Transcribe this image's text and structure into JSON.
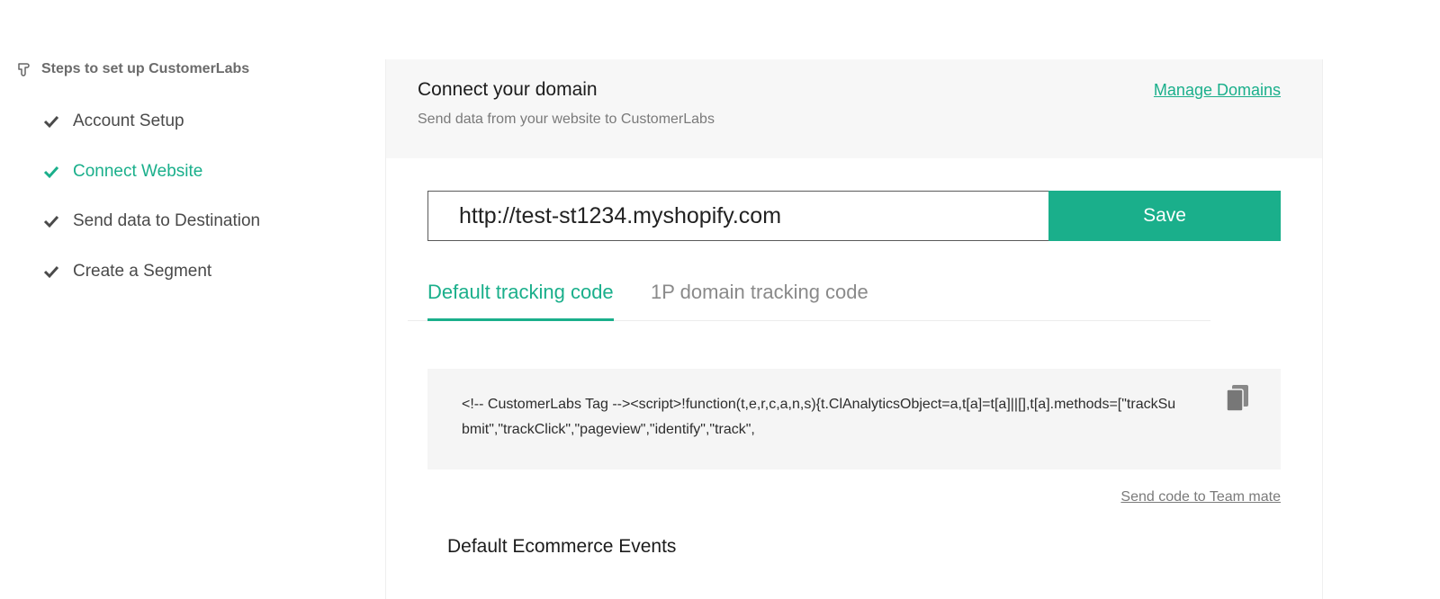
{
  "sidebar": {
    "header": "Steps to set up CustomerLabs",
    "steps": [
      {
        "label": "Account Setup",
        "active": false
      },
      {
        "label": "Connect Website",
        "active": true
      },
      {
        "label": "Send data to Destination",
        "active": false
      },
      {
        "label": "Create a Segment",
        "active": false
      }
    ]
  },
  "panel": {
    "title": "Connect your domain",
    "subtitle": "Send data from your website to CustomerLabs",
    "manage_link": "Manage Domains",
    "url_value": "http://test-st1234.myshopify.com",
    "save_label": "Save",
    "tabs": [
      {
        "label": "Default tracking code",
        "active": true
      },
      {
        "label": "1P domain tracking code",
        "active": false
      }
    ],
    "code_snippet": "<!-- CustomerLabs Tag --><script>!function(t,e,r,c,a,n,s){t.ClAnalyticsObject=a,t[a]=t[a]||[],t[a].methods=[\"trackSubmit\",\"trackClick\",\"pageview\",\"identify\",\"track\",",
    "send_link": "Send code to Team mate",
    "events_title": "Default Ecommerce Events"
  },
  "colors": {
    "accent": "#1aaf8b",
    "header_bg": "#f7f7f7",
    "code_bg": "#f5f5f5"
  }
}
